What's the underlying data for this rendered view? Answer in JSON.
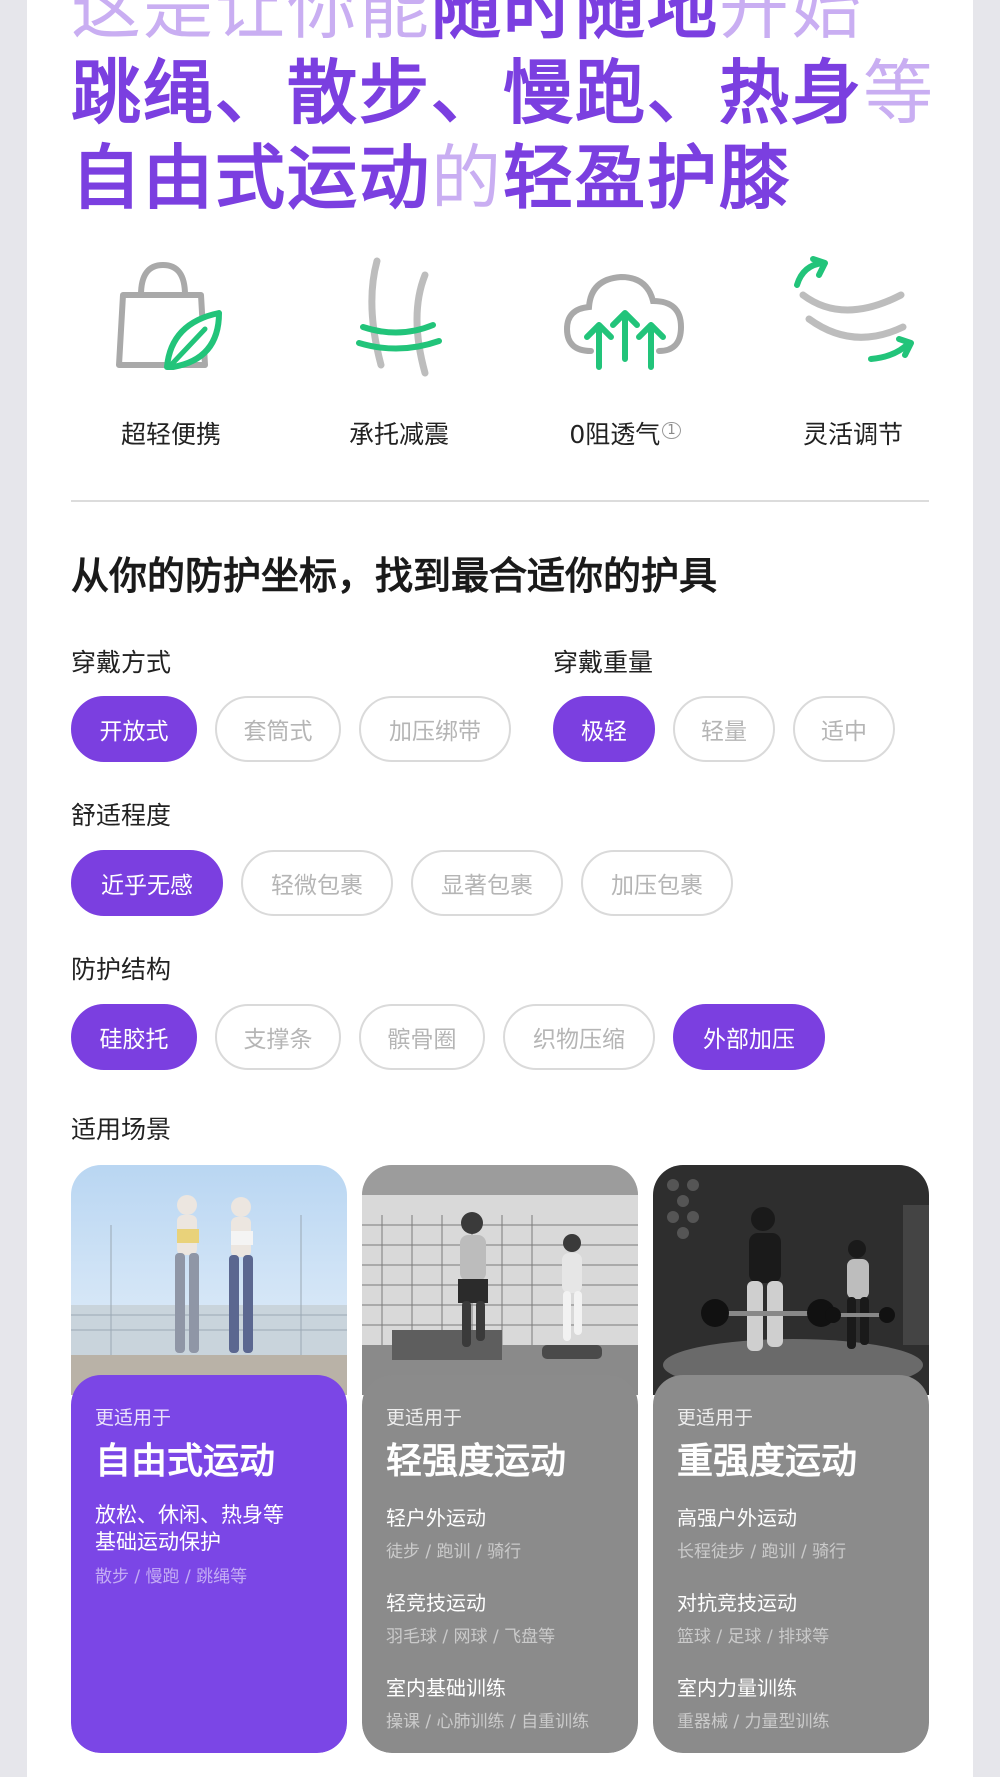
{
  "hero": {
    "line1_pre": "这是让你能",
    "line1_strong": "随时随地",
    "line1_post": "开始",
    "line2_strong": "跳绳、散步、慢跑、热身",
    "line2_light": "等",
    "line3_strong_a": "自由式运动",
    "line3_light": "的",
    "line3_strong_b": "轻盈护膝"
  },
  "features": [
    {
      "label": "超轻便携",
      "icon": "bag-leaf-icon"
    },
    {
      "label": "承托减震",
      "icon": "knee-support-icon"
    },
    {
      "label": "0阻透气",
      "icon": "cloud-arrows-icon",
      "note": "1"
    },
    {
      "label": "灵活调节",
      "icon": "flex-adjust-icon"
    }
  ],
  "section_title": "从你的防护坐标，找到最合适你的护具",
  "filters": {
    "wear_style": {
      "label": "穿戴方式",
      "options": [
        "开放式",
        "套筒式",
        "加压绑带"
      ],
      "selected": [
        "开放式"
      ]
    },
    "weight": {
      "label": "穿戴重量",
      "options": [
        "极轻",
        "轻量",
        "适中"
      ],
      "selected": [
        "极轻"
      ]
    },
    "comfort": {
      "label": "舒适程度",
      "options": [
        "近乎无感",
        "轻微包裹",
        "显著包裹",
        "加压包裹"
      ],
      "selected": [
        "近乎无感"
      ]
    },
    "structure": {
      "label": "防护结构",
      "options": [
        "硅胶托",
        "支撑条",
        "髌骨圈",
        "织物压缩",
        "外部加压"
      ],
      "selected": [
        "硅胶托",
        "外部加压"
      ]
    },
    "scenes_label": "适用场景"
  },
  "colors": {
    "accent": "#7b3fe0",
    "accent_light": "#c9aef2",
    "card_gray": "#8b8b8b"
  },
  "cards": [
    {
      "small": "更适用于",
      "title": "自由式运动",
      "desc_line1": "放松、休闲、热身等",
      "desc_line2": "基础运动保护",
      "sub": "散步 / 慢跑 / 跳绳等"
    },
    {
      "small": "更适用于",
      "title": "轻强度运动",
      "items": [
        {
          "title": "轻户外运动",
          "sub": "徒步 / 跑训 / 骑行"
        },
        {
          "title": "轻竞技运动",
          "sub": "羽毛球 / 网球 / 飞盘等"
        },
        {
          "title": "室内基础训练",
          "sub": "操课 / 心肺训练 / 自重训练"
        }
      ]
    },
    {
      "small": "更适用于",
      "title": "重强度运动",
      "items": [
        {
          "title": "高强户外运动",
          "sub": "长程徒步 / 跑训 / 骑行"
        },
        {
          "title": "对抗竞技运动",
          "sub": "篮球 / 足球 / 排球等"
        },
        {
          "title": "室内力量训练",
          "sub": "重器械 / 力量型训练"
        }
      ]
    }
  ]
}
